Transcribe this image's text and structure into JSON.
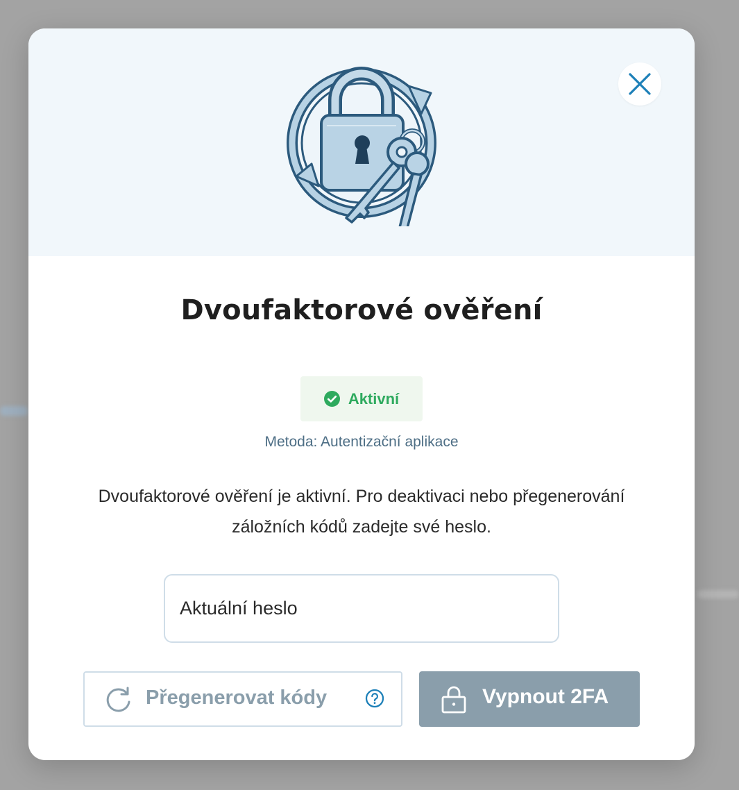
{
  "modal": {
    "title": "Dvoufaktorové ověření",
    "status": {
      "label": "Aktivní",
      "color": "#2eaa5e",
      "icon": "check-circle-icon"
    },
    "method_line": "Metoda: Autentizační aplikace",
    "description": "Dvoufaktorové ověření je aktivní. Pro deaktivaci nebo přegenerování záložních kódů zadejte své heslo.",
    "password_field": {
      "placeholder": "Aktuální heslo",
      "value": ""
    },
    "buttons": {
      "regenerate": {
        "label": "Přegenerovat kódy",
        "icon": "refresh-icon",
        "help_icon": "question-circle-icon",
        "disabled": true
      },
      "disable": {
        "label": "Vypnout 2FA",
        "icon": "lock-icon",
        "disabled": true
      }
    },
    "close_icon": "close-icon",
    "hero_icon": "padlock-keys-illustration"
  },
  "colors": {
    "accent": "#1d80b8",
    "success": "#2eaa5e",
    "muted_button": "#8a9eab",
    "hero_background": "#f1f7fb"
  }
}
